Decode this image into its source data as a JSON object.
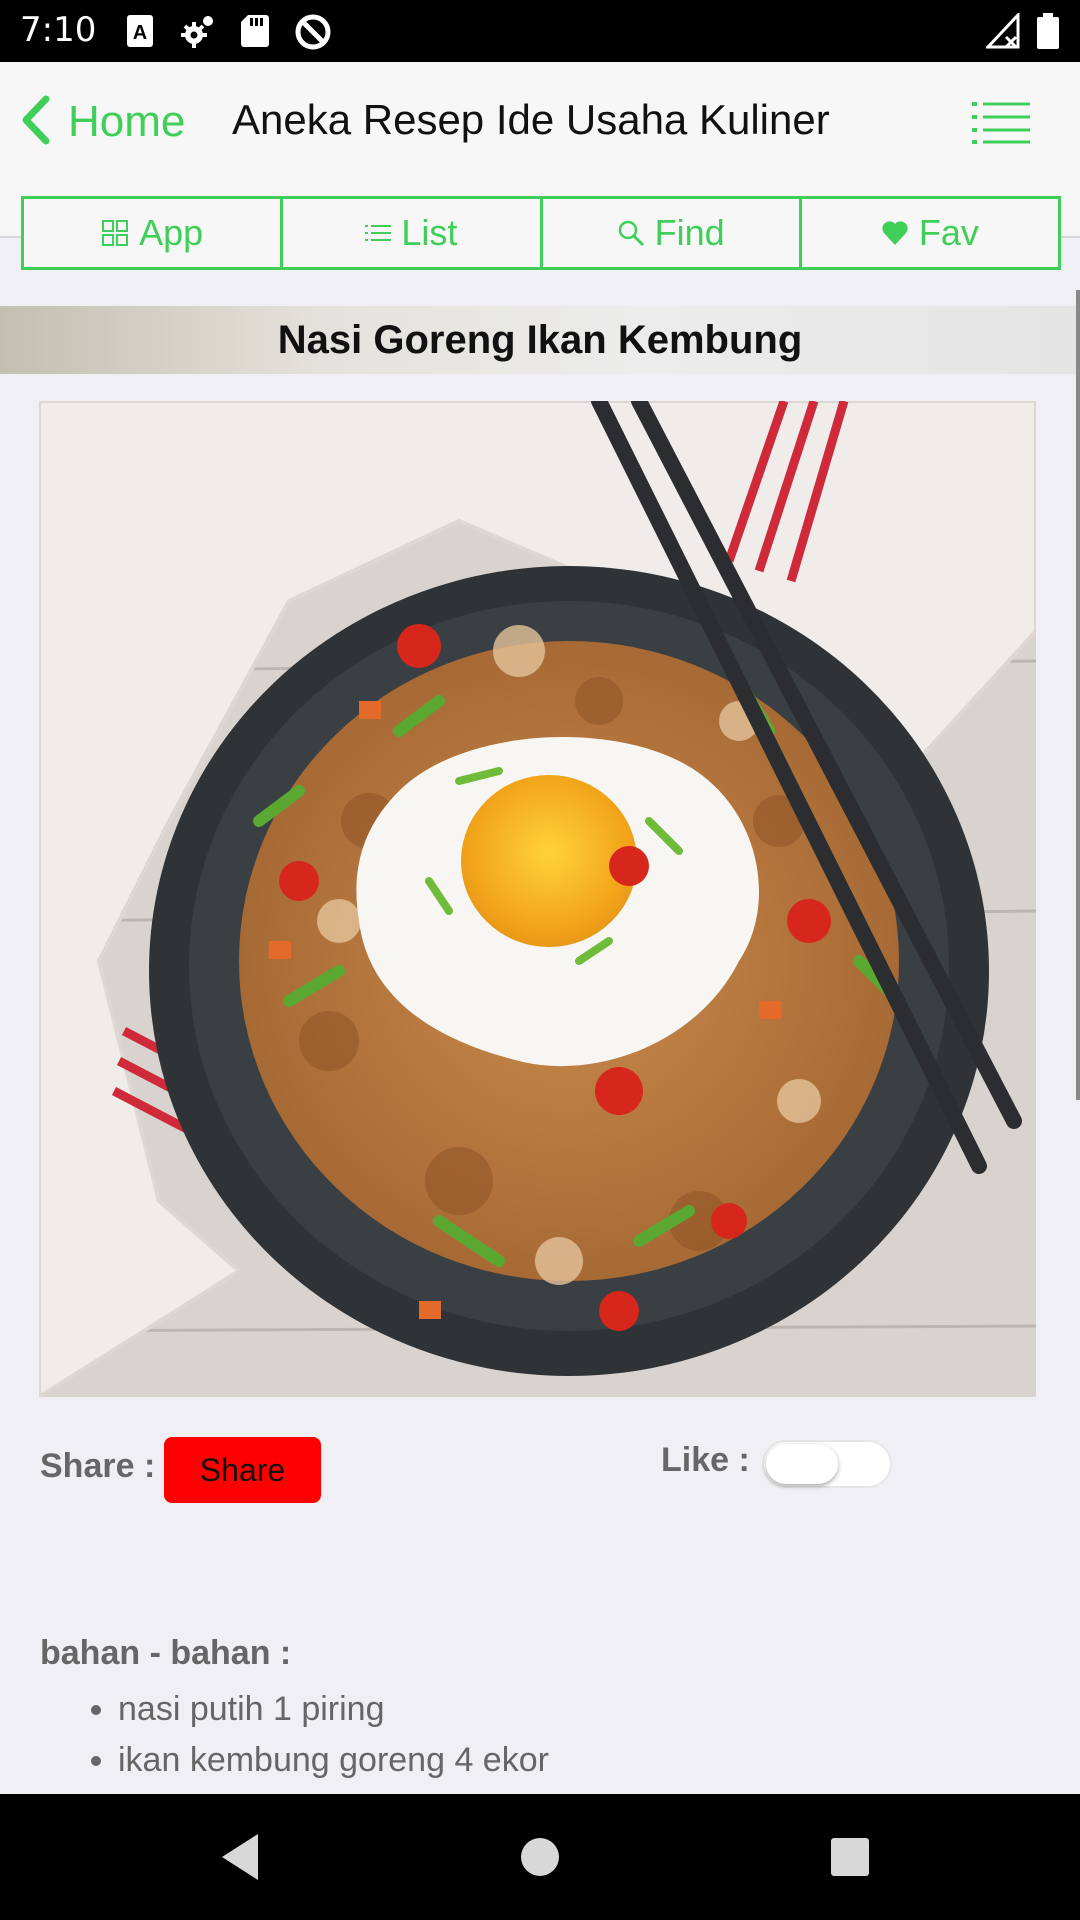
{
  "status_bar": {
    "time": "7:10",
    "icons": [
      "text-a-icon",
      "gear-icon",
      "sd-card-icon",
      "data-saver-icon",
      "signal-icon",
      "battery-icon"
    ]
  },
  "header": {
    "back_label": "Home",
    "title": "Aneka Resep Ide Usaha Kuliner",
    "menu_icon": "list-menu-icon",
    "accent_color": "#3fcf59"
  },
  "tabs": [
    {
      "label": "App",
      "icon": "grid-icon"
    },
    {
      "label": "List",
      "icon": "list-icon"
    },
    {
      "label": "Find",
      "icon": "search-icon"
    },
    {
      "label": "Fav",
      "icon": "heart-icon"
    }
  ],
  "recipe": {
    "title": "Nasi Goreng Ikan Kembung",
    "share_label": "Share :",
    "share_button": "Share",
    "share_color": "#ff0000",
    "like_label": "Like :",
    "like_on": false,
    "ingredients_heading": "bahan - bahan :",
    "ingredients": [
      "nasi putih 1 piring",
      "ikan kembung goreng 4 ekor"
    ]
  },
  "nav": [
    "back-icon",
    "home-icon",
    "recents-icon"
  ]
}
